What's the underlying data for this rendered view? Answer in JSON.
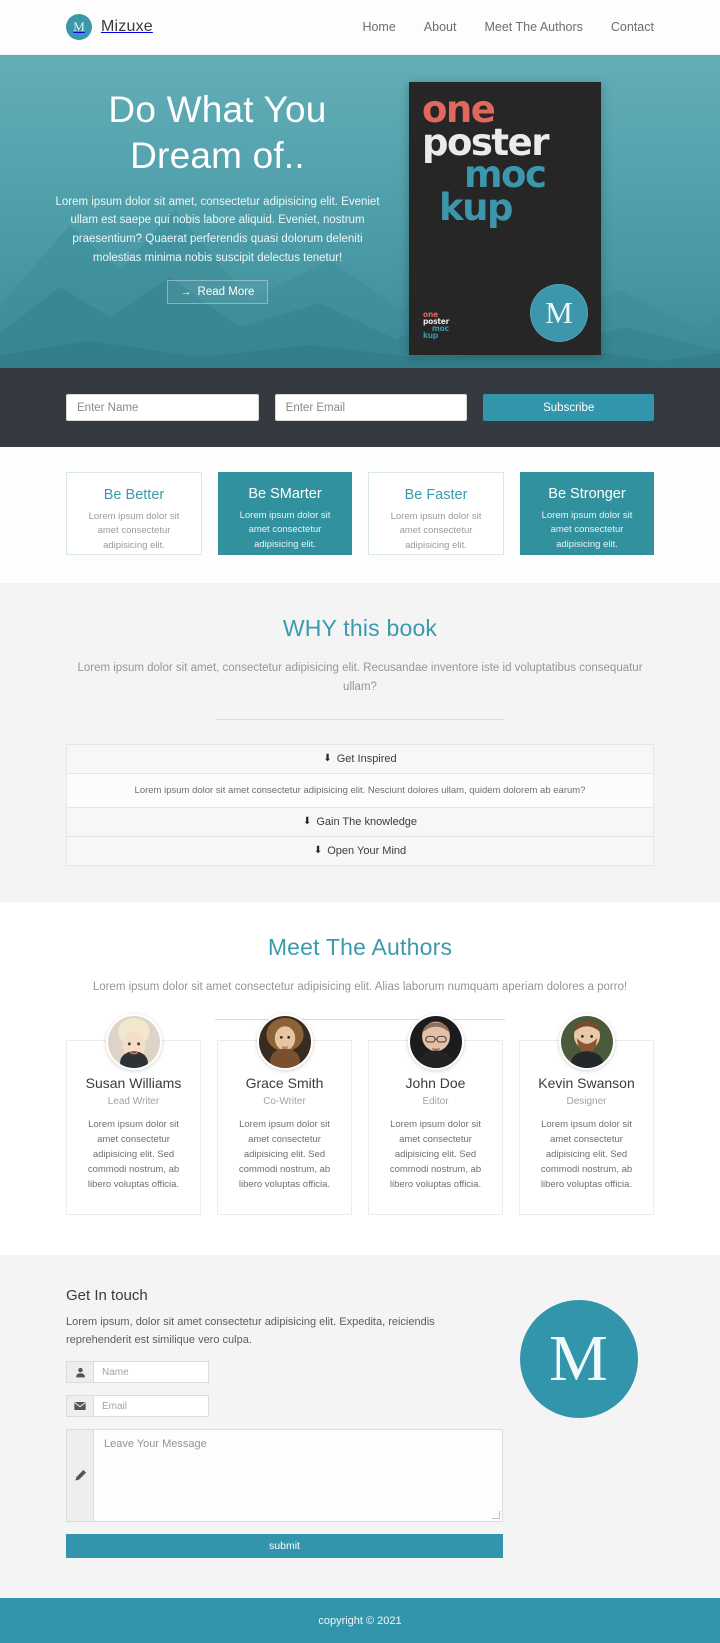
{
  "nav": {
    "brand": "Mizuxe",
    "brand_initial": "M",
    "links": [
      "Home",
      "About",
      "Meet The Authors",
      "Contact"
    ]
  },
  "hero": {
    "title_line1": "Do What You",
    "title_line2": "Dream of..",
    "description": "Lorem ipsum dolor sit amet, consectetur adipisicing elit. Eveniet ullam est saepe qui nobis labore aliquid. Eveniet, nostrum praesentium? Quaerat perferendis quasi dolorum deleniti molestias minima nobis suscipit delectus tenetur!",
    "read_more": "Read More",
    "arrow_icon": "→",
    "poster": {
      "line1": "one",
      "line2": "poster",
      "line3": "moc",
      "line4": "kup",
      "badge_letter": "M"
    }
  },
  "subscribe": {
    "name_placeholder": "Enter Name",
    "email_placeholder": "Enter Email",
    "button_label": "Subscribe"
  },
  "features": [
    {
      "title": "Be Better",
      "text": "Lorem ipsum dolor sit amet consectetur adipisicing elit.",
      "style": "light"
    },
    {
      "title": "Be SMarter",
      "text": "Lorem ipsum dolor sit amet consectetur adipisicing elit.",
      "style": "dark"
    },
    {
      "title": "Be Faster",
      "text": "Lorem ipsum dolor sit amet consectetur adipisicing elit.",
      "style": "light"
    },
    {
      "title": "Be Stronger",
      "text": "Lorem ipsum dolor sit amet consectetur adipisicing elit.",
      "style": "dark"
    }
  ],
  "why": {
    "title": "WHY this book",
    "subtitle": "Lorem ipsum dolor sit amet, consectetur adipisicing elit. Recusandae inventore iste id voluptatibus consequatur ullam?",
    "accordion": [
      {
        "label": "Get Inspired",
        "body": "Lorem ipsum dolor sit amet consectetur adipisicing elit. Nesciunt dolores ullam, quidem dolorem ab earum?"
      },
      {
        "label": "Gain The knowledge",
        "body": null
      },
      {
        "label": "Open Your Mind",
        "body": null
      }
    ],
    "icon": "⬇"
  },
  "authors": {
    "title": "Meet The Authors",
    "subtitle": "Lorem ipsum dolor sit amet consectetur adipisicing elit. Alias laborum numquam aperiam dolores a porro!",
    "people": [
      {
        "name": "Susan Williams",
        "role": "Lead Writer",
        "bio": "Lorem ipsum dolor sit amet consectetur adipisicing elit. Sed commodi nostrum, ab libero voluptas officia."
      },
      {
        "name": "Grace Smith",
        "role": "Co-Writer",
        "bio": "Lorem ipsum dolor sit amet consectetur adipisicing elit. Sed commodi nostrum, ab libero voluptas officia."
      },
      {
        "name": "John Doe",
        "role": "Editor",
        "bio": "Lorem ipsum dolor sit amet consectetur adipisicing elit. Sed commodi nostrum, ab libero voluptas officia."
      },
      {
        "name": "Kevin Swanson",
        "role": "Designer",
        "bio": "Lorem ipsum dolor sit amet consectetur adipisicing elit. Sed commodi nostrum, ab libero voluptas officia."
      }
    ]
  },
  "contact": {
    "title": "Get In touch",
    "description": "Lorem ipsum, dolor sit amet consectetur adipisicing elit. Expedita, reiciendis reprehenderit est similique vero culpa.",
    "name_placeholder": "Name",
    "email_placeholder": "Email",
    "message_placeholder": "Leave Your Message",
    "submit_label": "submit",
    "logo_letter": "M"
  },
  "footer": {
    "text": "copyright © 2021"
  },
  "colors": {
    "teal": "#3295ab",
    "teal_card": "#31919f",
    "dark_bar": "#343a40",
    "poster_bg": "#262626",
    "poster_red": "#e2675f",
    "poster_blue": "#3c97ad"
  }
}
